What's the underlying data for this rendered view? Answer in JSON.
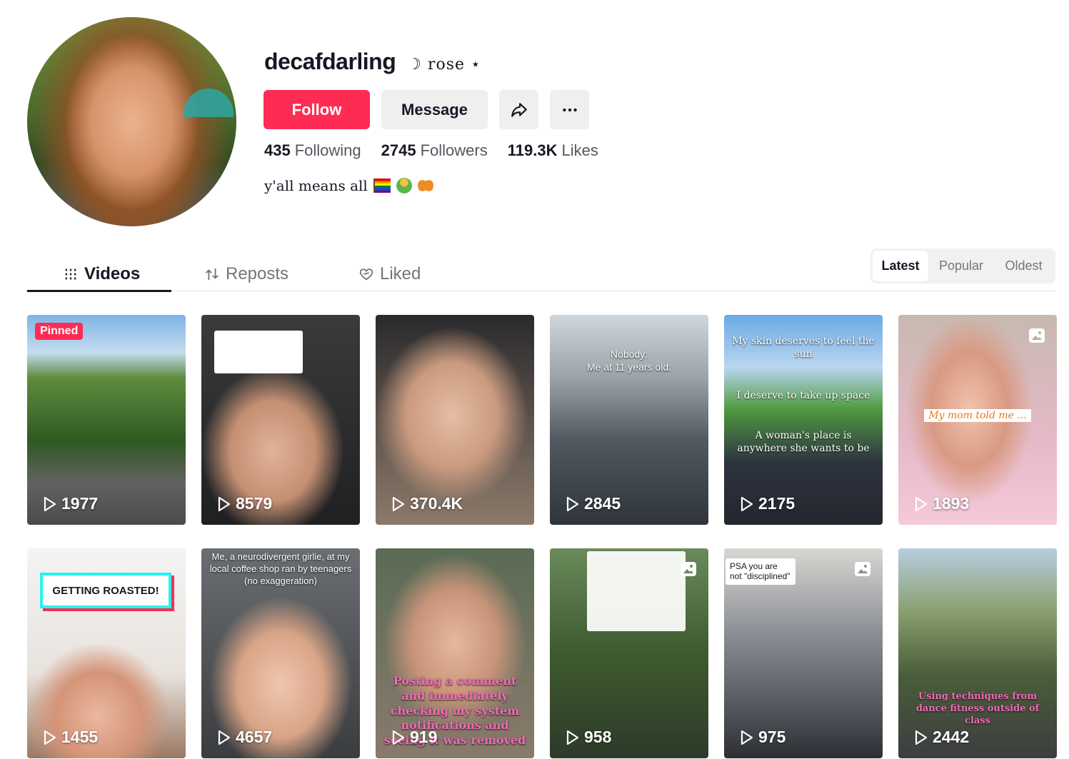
{
  "profile": {
    "username": "decafdarling",
    "nickname": "☽ rose ⋆",
    "bio_text": "y'all means all",
    "bio_emojis": [
      "rainbow-flag",
      "person-in-lotus-position",
      "butterfly"
    ],
    "stats": [
      {
        "value": "435",
        "label": "Following"
      },
      {
        "value": "2745",
        "label": "Followers"
      },
      {
        "value": "119.3K",
        "label": "Likes"
      }
    ]
  },
  "actions": {
    "follow_label": "Follow",
    "message_label": "Message",
    "share_icon": "share-icon",
    "more_icon": "more-icon"
  },
  "tabs": [
    {
      "label": "Videos",
      "icon": "grid-icon",
      "active": true
    },
    {
      "label": "Reposts",
      "icon": "repost-icon",
      "active": false
    },
    {
      "label": "Liked",
      "icon": "heart-icon",
      "active": false
    }
  ],
  "sort": {
    "options": [
      "Latest",
      "Popular",
      "Oldest"
    ],
    "selected": "Latest"
  },
  "videos": [
    {
      "views": "1977",
      "pinned": "Pinned"
    },
    {
      "views": "8579"
    },
    {
      "views": "370.4K"
    },
    {
      "views": "2845",
      "overlay": "Nobody:\nMe at 11 years old:"
    },
    {
      "views": "2175",
      "overlay_top": "My skin deserves to feel the sun",
      "overlay_mid": "I deserve to take up space",
      "overlay_bottom": "A woman's place is anywhere she wants to be"
    },
    {
      "views": "1893",
      "overlay": "My mom told me ..."
    },
    {
      "views": "1455",
      "overlay": "GETTING ROASTED!"
    },
    {
      "views": "4657",
      "overlay": "Me, a neurodivergent girlie, at my local coffee shop ran by teenagers (no exaggeration)"
    },
    {
      "views": "919",
      "overlay": "Posting a comment and immediately checking my system notifications and seeing it was removed"
    },
    {
      "views": "958"
    },
    {
      "views": "975",
      "overlay": "PSA you are not \"disciplined\""
    },
    {
      "views": "2442",
      "overlay": "Using techniques from dance fitness outside of class"
    }
  ],
  "colors": {
    "accent": "#fe2c55",
    "text_primary": "#161823",
    "text_secondary": "#73757c",
    "button_bg": "#efeff0"
  }
}
